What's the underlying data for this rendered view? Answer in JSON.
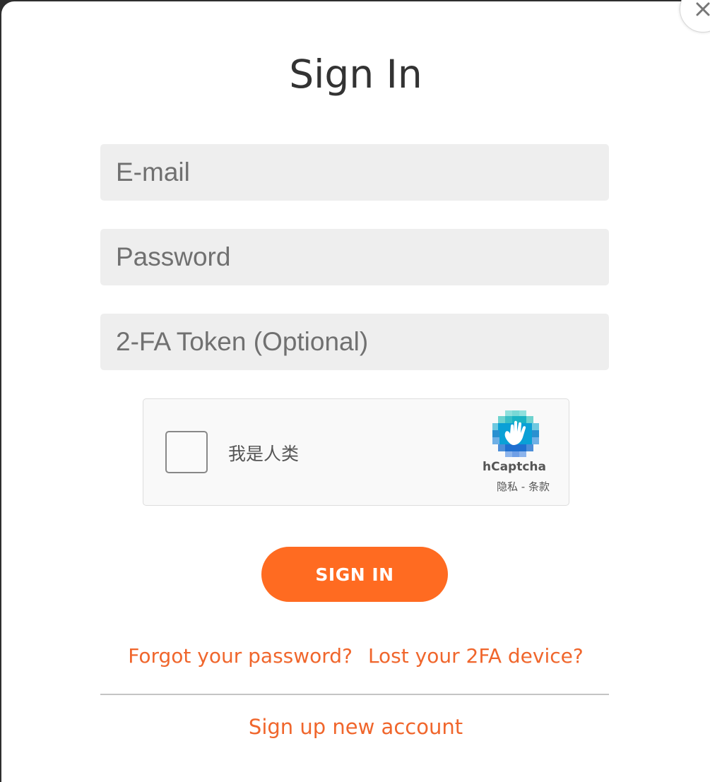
{
  "modal": {
    "title": "Sign In"
  },
  "form": {
    "email_placeholder": "E-mail",
    "password_placeholder": "Password",
    "token_placeholder": "2-FA Token (Optional)",
    "submit_label": "SIGN IN"
  },
  "captcha": {
    "label": "我是人类",
    "brand": "hCaptcha",
    "privacy_label": "隐私",
    "separator": " - ",
    "terms_label": "条款"
  },
  "links": {
    "forgot_password": "Forgot your password?",
    "lost_2fa": "Lost your 2FA device?",
    "signup": "Sign up new account"
  },
  "icons": {
    "close": "close-icon",
    "captcha_logo": "hcaptcha-hand-logo"
  },
  "colors": {
    "accent": "#ff6b21",
    "link": "#f0662c",
    "field_bg": "#eeeeee"
  }
}
